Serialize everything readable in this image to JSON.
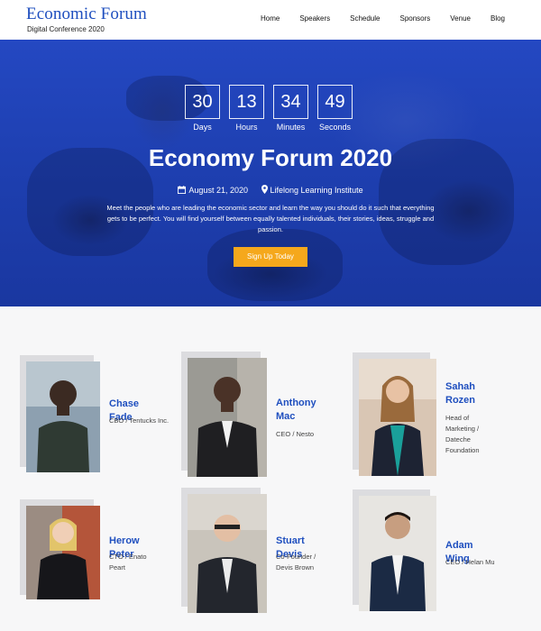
{
  "header": {
    "logo_title": "Economic Forum",
    "logo_subtitle": "Digital Conference 2020",
    "nav": [
      "Home",
      "Speakers",
      "Schedule",
      "Sponsors",
      "Venue",
      "Blog"
    ]
  },
  "hero": {
    "countdown": [
      {
        "value": "30",
        "label": "Days"
      },
      {
        "value": "13",
        "label": "Hours"
      },
      {
        "value": "34",
        "label": "Minutes"
      },
      {
        "value": "49",
        "label": "Seconds"
      }
    ],
    "title": "Economy Forum 2020",
    "date": "August 21, 2020",
    "venue": "Lifelong Learning Institute",
    "description": "Meet the people who are leading the economic sector and learn the way you should do it such that everything gets to be perfect. You will find yourself between equally talented individuals, their stories, ideas, struggle and passion.",
    "cta_label": "Sign Up Today"
  },
  "speakers": [
    {
      "name": "Chase Fade",
      "role": "CBO / Tentucks Inc."
    },
    {
      "name": "Anthony Mac",
      "role": "CEO / Nesto"
    },
    {
      "name": "Sahah Rozen",
      "role": "Head of Marketing / Dateche Foundation"
    },
    {
      "name": "Herow Peter",
      "role": "CTO / Enato Peart"
    },
    {
      "name": "Stuart Devis",
      "role": "Co-Founder / Devis Brown"
    },
    {
      "name": "Adam Wing",
      "role": "CEO / Helan Mu"
    }
  ],
  "colors": {
    "brand": "#1f4fbf",
    "hero_bg": "#1e3eb0",
    "cta": "#f5a81c",
    "photo_backdrop": "#dcdcdf"
  }
}
